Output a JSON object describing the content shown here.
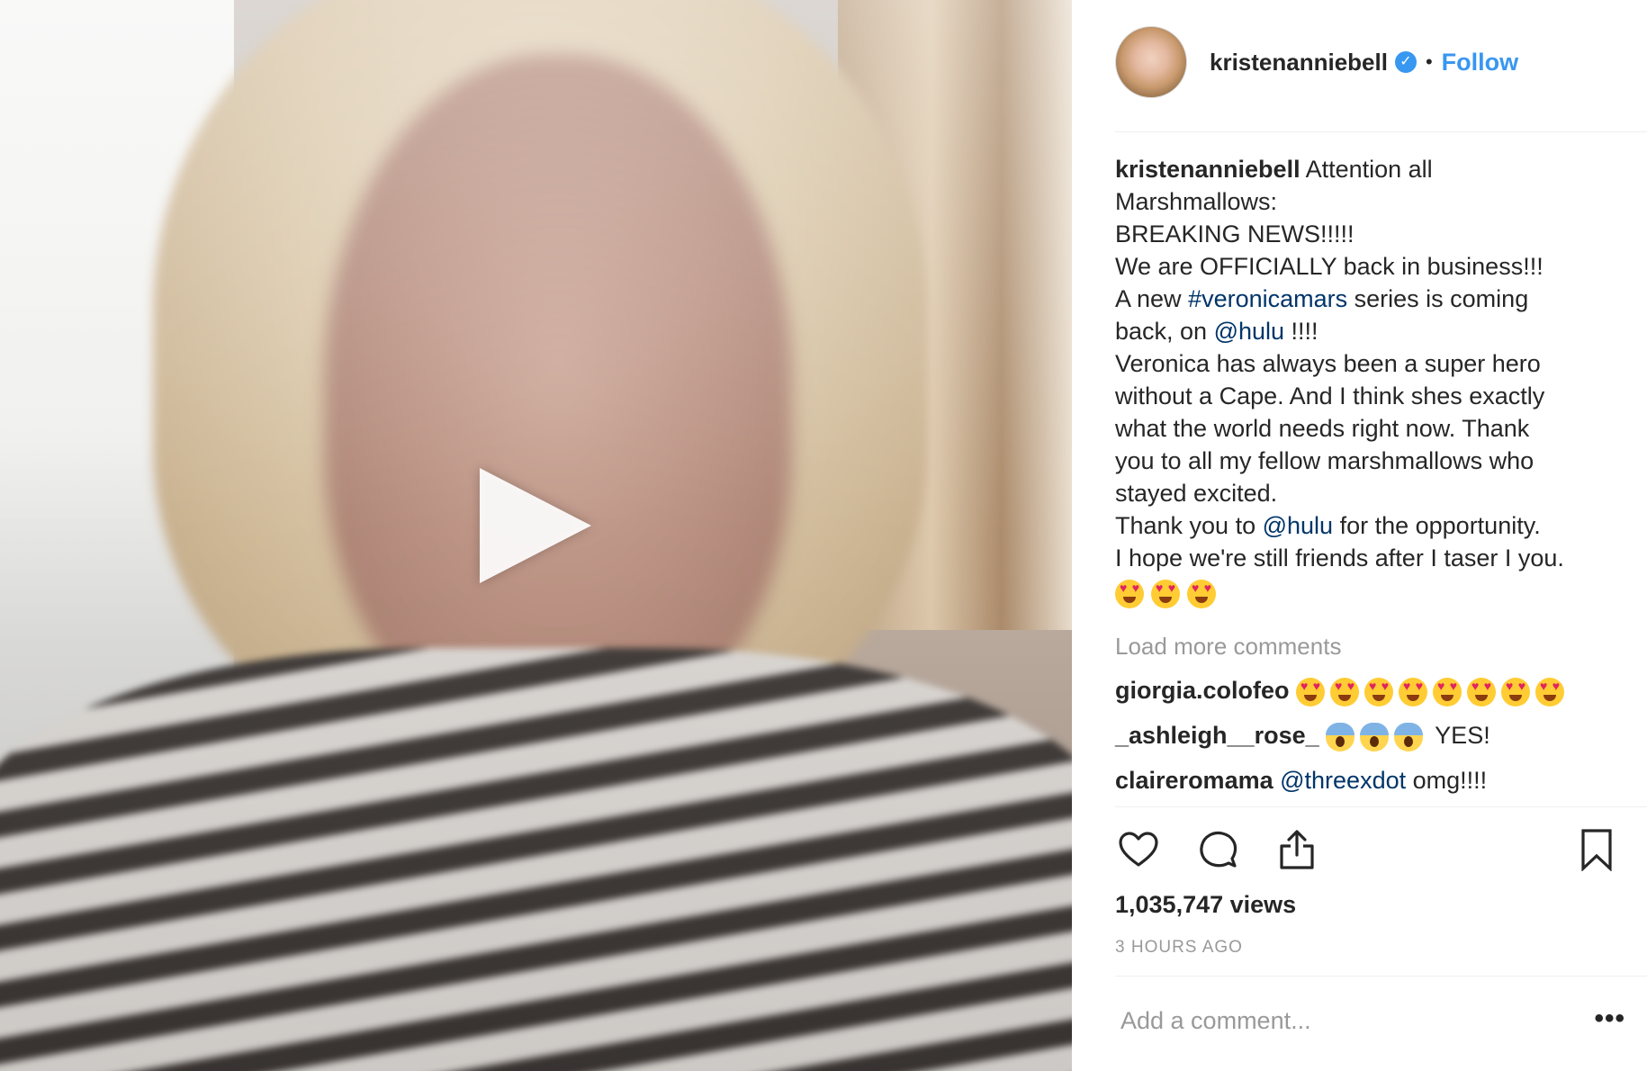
{
  "header": {
    "username": "kristenanniebell",
    "separator": "•",
    "follow_label": "Follow"
  },
  "caption": {
    "username": "kristenanniebell",
    "part1": " Attention all\nMarshmallows:\nBREAKING NEWS!!!!!\nWe are OFFICIALLY back in business!!!\nA new ",
    "hashtag": "#veronicamars",
    "part2": " series is coming\nback, on ",
    "mention1": "@hulu",
    "part3": " !!!!\nVeronica has always been a super hero\nwithout a Cape. And I think shes exactly\nwhat the world needs right now. Thank\nyou to all my fellow marshmallows who\nstayed excited.\nThank you to ",
    "mention2": "@hulu",
    "part4": " for the opportunity.\nI hope we're still friends after I taser I you.",
    "emoji_count": 3
  },
  "load_more_label": "Load more comments",
  "comments": [
    {
      "username": "giorgia.colofeo",
      "emoji": "heart-eyes",
      "emoji_count": 8,
      "text": ""
    },
    {
      "username": "_ashleigh__rose_",
      "emoji": "scream",
      "emoji_count": 3,
      "text": "YES!"
    },
    {
      "username": "claireromama",
      "mention": "@threexdot",
      "text": " omg!!!!"
    }
  ],
  "stats": {
    "views": "1,035,747 views",
    "timestamp": "3 HOURS AGO"
  },
  "composer": {
    "placeholder": "Add a comment...",
    "more_label": "•••"
  },
  "icons": {
    "play": "play-icon",
    "verified": "verified-badge-icon",
    "like": "heart-icon",
    "comment": "speech-bubble-icon",
    "share": "share-icon",
    "save": "bookmark-icon",
    "more": "more-options-icon"
  },
  "colors": {
    "accent": "#3897f0",
    "link": "#003569",
    "muted": "#999999",
    "text": "#262626"
  }
}
